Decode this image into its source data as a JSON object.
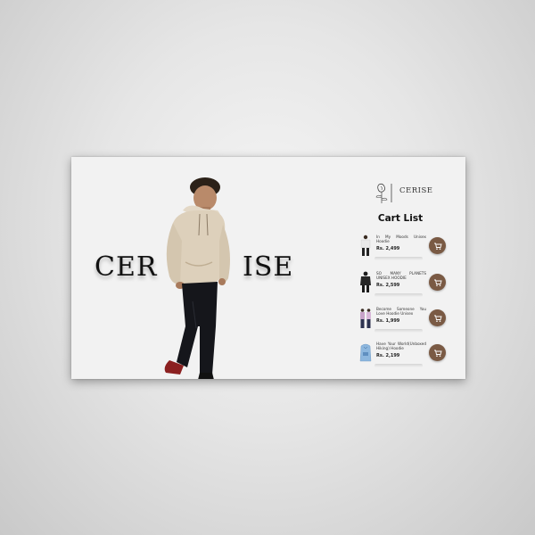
{
  "brand": {
    "logo_text": "CERISE",
    "hero_left": "CER",
    "hero_right": "ISE"
  },
  "cart": {
    "title": "Cart List",
    "items": [
      {
        "name": "In My Moods Unisex Hoodie",
        "price": "Rs. 2,499",
        "icon": "cart-icon"
      },
      {
        "name": "SO MANY PLANETS UNISEX HOODIE",
        "price": "Rs. 2,599",
        "icon": "cart-icon"
      },
      {
        "name": "Become Someone You Love Hoodie Unisex",
        "price": "Rs. 1,999",
        "icon": "cart-icon"
      },
      {
        "name": "Have Your World(Unboxed Hiking) Hoodie",
        "price": "Rs. 2,199",
        "icon": "cart-icon"
      }
    ]
  },
  "colors": {
    "card_bg": "#f2f2f2",
    "accent_brown": "#7a5a44",
    "text_dark": "#111111"
  }
}
